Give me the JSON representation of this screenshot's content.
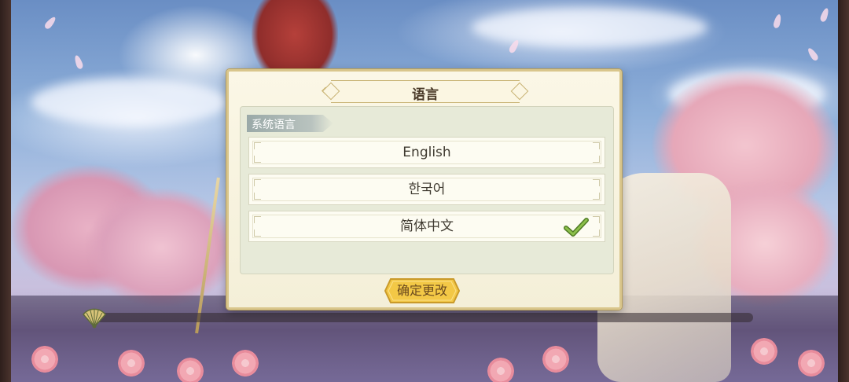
{
  "dialog": {
    "title": "语言",
    "section_label": "系统语言",
    "options": [
      {
        "label": "English",
        "selected": false
      },
      {
        "label": "한국어",
        "selected": false
      },
      {
        "label": "简体中文",
        "selected": true
      }
    ],
    "confirm_label": "确定更改"
  },
  "loading": {
    "progress": 0.0
  },
  "colors": {
    "dialog_bg": "#fbf7e6",
    "dialog_border": "#d9c68c",
    "panel_bg": "#e7ead8",
    "confirm_button": "#f3c846",
    "checkmark": "#7aa53c"
  },
  "icons": {
    "title_ornament": "diamond-ornament-icon",
    "selected": "checkmark-icon",
    "loading": "fan-icon"
  }
}
